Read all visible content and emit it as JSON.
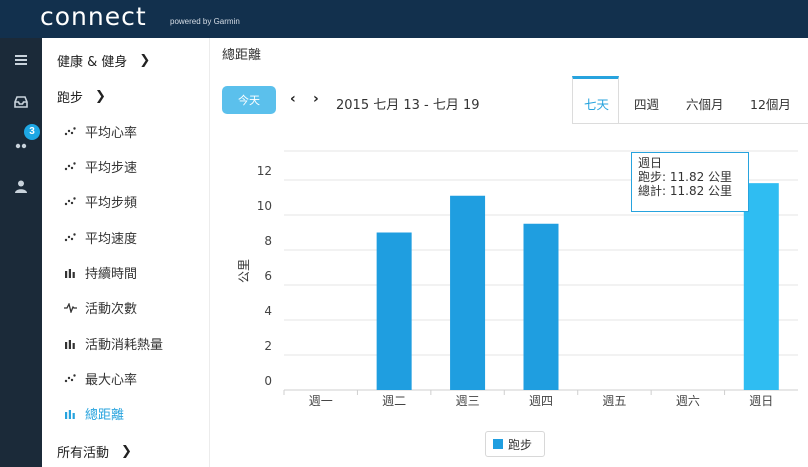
{
  "header": {
    "logo": "connect",
    "logo_sub": "powered by Garmin"
  },
  "rail": {
    "icons": [
      "menu-icon",
      "inbox-icon",
      "connections-icon",
      "user-icon"
    ],
    "badge": "3"
  },
  "sidebar": {
    "health_header": "健康 & 健身",
    "running_header": "跑步",
    "items": [
      {
        "label": "平均心率",
        "icon": "scatter-icon"
      },
      {
        "label": "平均步速",
        "icon": "scatter-icon"
      },
      {
        "label": "平均步頻",
        "icon": "scatter-icon"
      },
      {
        "label": "平均速度",
        "icon": "scatter-icon"
      },
      {
        "label": "持續時間",
        "icon": "bar-icon"
      },
      {
        "label": "活動次數",
        "icon": "pulse-icon"
      },
      {
        "label": "活動消耗熱量",
        "icon": "bar-icon"
      },
      {
        "label": "最大心率",
        "icon": "scatter-icon"
      },
      {
        "label": "總距離",
        "icon": "bar-icon",
        "active": true
      }
    ],
    "all_activities": "所有活動"
  },
  "main": {
    "title": "總距離",
    "today_button": "今天",
    "date_range": "2015 七月 13 - 七月 19",
    "tabs": [
      {
        "label": "七天",
        "active": true
      },
      {
        "label": "四週"
      },
      {
        "label": "六個月"
      },
      {
        "label": "12個月"
      }
    ]
  },
  "tooltip": {
    "title": "週日",
    "line1": "跑步: 11.82 公里",
    "line2": "總計: 11.82 公里"
  },
  "colors": {
    "accent": "#27a3de",
    "bar": "#1f9ee0",
    "header": "#12304d",
    "rail": "#1b2a39"
  },
  "chart_data": {
    "type": "bar",
    "categories": [
      "週一",
      "週二",
      "週三",
      "週四",
      "週五",
      "週六",
      "週日"
    ],
    "series": [
      {
        "name": "跑步",
        "values": [
          0,
          9.0,
          11.1,
          9.5,
          0,
          0,
          11.82
        ]
      }
    ],
    "ylabel": "公里",
    "yticks": [
      0,
      2,
      4,
      6,
      8,
      10,
      12
    ],
    "ylim": [
      0,
      13
    ],
    "grid": true,
    "legend": "bottom-center"
  }
}
